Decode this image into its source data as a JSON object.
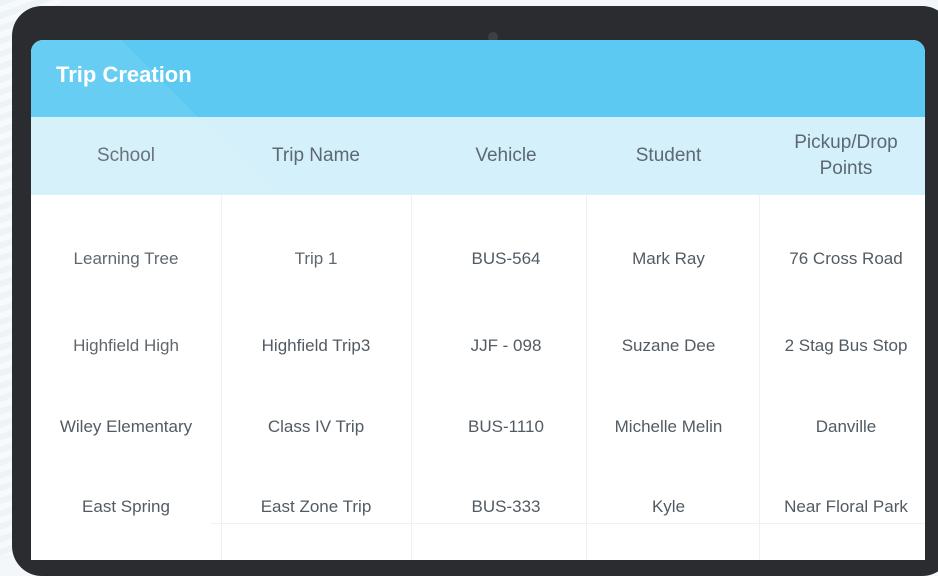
{
  "title": "Trip Creation",
  "columns": [
    "School",
    "Trip Name",
    "Vehicle",
    "Student",
    "Pickup/Drop Points"
  ],
  "rows": [
    [
      "Learning Tree",
      "Trip 1",
      "BUS-564",
      "Mark Ray",
      "76 Cross Road"
    ],
    [
      "Highfield High",
      "Highfield Trip3",
      "JJF - 098",
      "Suzane Dee",
      "2 Stag Bus Stop"
    ],
    [
      "Wiley Elementary",
      "Class IV Trip",
      "BUS-1110",
      "Michelle Melin",
      "Danville"
    ],
    [
      "East Spring",
      "East Zone Trip",
      "BUS-333",
      "Kyle",
      "Near Floral Park"
    ]
  ],
  "colors": {
    "title_bar": "#5bc9f1",
    "header_row": "#d4f0fb",
    "device_frame": "#2b2c30"
  }
}
